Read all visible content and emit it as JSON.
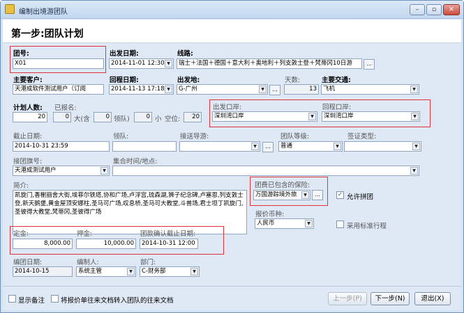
{
  "window": {
    "title": "编制出境游团队"
  },
  "header": {
    "title": "第一步:团队计划"
  },
  "group_no": {
    "label": "团号:",
    "value": "X01"
  },
  "depart_date": {
    "label": "出发日期:",
    "value": "2014-11-01 12:30"
  },
  "route": {
    "label": "线路:",
    "value": "瑞士＋法国＋德国＋意大利＋奥地利＋列支敦士登＋梵蒂冈10日游"
  },
  "main_customer": {
    "label": "主要客户:",
    "value": "天港成软件测试用户（订阅"
  },
  "return_date": {
    "label": "回程日期:",
    "value": "2014-11-13 17:18"
  },
  "depart_place": {
    "label": "出发地:",
    "value": "G-广州"
  },
  "days": {
    "label": "天数:",
    "value": "13"
  },
  "main_transport": {
    "label": "主要交通:",
    "value": "飞机"
  },
  "plan_people": {
    "label": "计划人数:",
    "value": "20"
  },
  "registered": {
    "label": "已报名:",
    "value": "0"
  },
  "adult_label": "大(含",
  "adult": "0",
  "lead_label": "领队)",
  "lead": "0",
  "child_label": "小",
  "vacancy_label": "空位:",
  "vacancy": "20",
  "depart_port": {
    "label": "出发口岸:",
    "value": "深圳湾口岸"
  },
  "return_port": {
    "label": "回程口岸:",
    "value": "深圳湾口岸"
  },
  "deadline": {
    "label": "截止日期:",
    "value": "2014-10-31 23:59"
  },
  "tour_leader": {
    "label": "领队:",
    "value": ""
  },
  "guide": {
    "label": "接送导游:",
    "value": ""
  },
  "level": {
    "label": "团队等级:",
    "value": "普通"
  },
  "visa_type": {
    "label": "签证类型:",
    "value": ""
  },
  "pickup_flag": {
    "label": "接团旗号:",
    "value": "天港成测试用户"
  },
  "meeting": {
    "label": "集合时间/地点:",
    "value": ""
  },
  "intro": {
    "label": "简介:",
    "value": "凯旋门,香榭丽舍大街,埃菲尔铁塔,协和广场,卢浮宫,琉森湖,狮子纪念碑,卢塞恩,列支敦士登,新天鹅堡,黄金屋顶安娜柱,圣马可广场,叹息桥,圣马可大教堂,斗兽场,君士坦丁凯旋门,圣彼得大教堂,梵蒂冈,圣彼得广场"
  },
  "insurance": {
    "label": "团费已包含的保险:",
    "value": "万国游踪境外旅"
  },
  "allow_merge": {
    "label": "允许拼团",
    "checked": true
  },
  "currency": {
    "label": "报价币种:",
    "value": "人民币"
  },
  "std_itinerary": {
    "label": "采用标准行程",
    "checked": false
  },
  "deposit": {
    "label": "定金:",
    "value": "8,000.00"
  },
  "guarantee": {
    "label": "押金:",
    "value": "10,000.00"
  },
  "fee_deadline": {
    "label": "团款确认截止日期:",
    "value": "2014-10-31 12:00"
  },
  "compile_date": {
    "label": "编团日期:",
    "value": "2014-10-15"
  },
  "compiler": {
    "label": "编制人:",
    "value": "系统主管"
  },
  "department": {
    "label": "部门:",
    "value": "C-财务部"
  },
  "footer": {
    "show_notes": "显示备注",
    "transfer_docs": "将报价单往来文档转入团队的往来文档",
    "prev": "上一步(P)",
    "next": "下一步(N)",
    "exit": "退出(X)"
  },
  "icons": {
    "dropdown": "▼",
    "ellipsis": "...",
    "check": "✓"
  }
}
